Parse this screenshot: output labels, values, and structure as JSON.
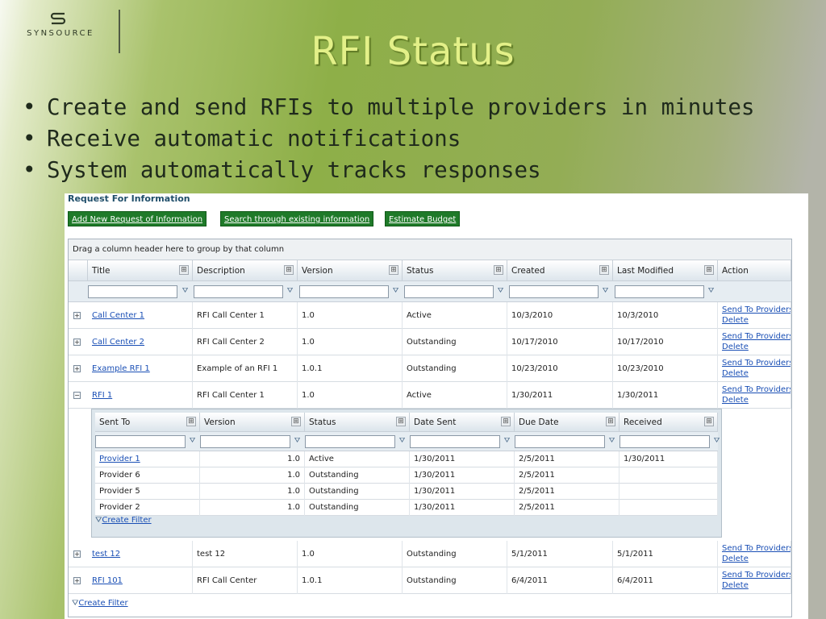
{
  "logo": {
    "text": "SYNSOURCE"
  },
  "slide_title": "RFI Status",
  "bullets": [
    "Create and send RFIs to multiple providers in minutes",
    "Receive automatic notifications",
    "System automatically tracks responses"
  ],
  "panel": {
    "title": "Request For Information",
    "buttons": {
      "add_new": "Add New Request of Information",
      "search": "Search through existing information",
      "estimate": "Estimate Budget"
    },
    "group_hint": "Drag a column header here to group by that column",
    "columns": [
      "Title",
      "Description",
      "Version",
      "Status",
      "Created",
      "Last Modified",
      "Action"
    ],
    "rows": [
      {
        "title": "Call Center 1",
        "description": "RFI Call Center 1",
        "version": "1.0",
        "status": "Active",
        "created": "10/3/2010",
        "modified": "10/3/2010"
      },
      {
        "title": "Call Center 2",
        "description": "RFI Call Center 2",
        "version": "1.0",
        "status": "Outstanding",
        "created": "10/17/2010",
        "modified": "10/17/2010"
      },
      {
        "title": "Example RFI 1",
        "description": "Example of an RFI 1",
        "version": "1.0.1",
        "status": "Outstanding",
        "created": "10/23/2010",
        "modified": "10/23/2010"
      },
      {
        "title": "RFI 1",
        "description": "RFI Call Center 1",
        "version": "1.0",
        "status": "Active",
        "created": "1/30/2011",
        "modified": "1/30/2011"
      },
      {
        "title": "test 12",
        "description": "test 12",
        "version": "1.0",
        "status": "Outstanding",
        "created": "5/1/2011",
        "modified": "5/1/2011"
      },
      {
        "title": "RFI 101",
        "description": "RFI Call Center",
        "version": "1.0.1",
        "status": "Outstanding",
        "created": "6/4/2011",
        "modified": "6/4/2011"
      }
    ],
    "action_send": "Send To Providers",
    "action_delete": "Delete",
    "child": {
      "columns": [
        "Sent To",
        "Version",
        "Status",
        "Date Sent",
        "Due Date",
        "Received"
      ],
      "rows": [
        {
          "sent_to": "Provider 1",
          "version": "1.0",
          "status": "Active",
          "date_sent": "1/30/2011",
          "due_date": "2/5/2011",
          "received": "1/30/2011"
        },
        {
          "sent_to": "Provider 6",
          "version": "1.0",
          "status": "Outstanding",
          "date_sent": "1/30/2011",
          "due_date": "2/5/2011",
          "received": ""
        },
        {
          "sent_to": "Provider 5",
          "version": "1.0",
          "status": "Outstanding",
          "date_sent": "1/30/2011",
          "due_date": "2/5/2011",
          "received": ""
        },
        {
          "sent_to": "Provider 2",
          "version": "1.0",
          "status": "Outstanding",
          "date_sent": "1/30/2011",
          "due_date": "2/5/2011",
          "received": ""
        }
      ],
      "create_filter": "Create Filter"
    },
    "create_filter": "Create Filter"
  },
  "colors": {
    "title": "#e3f088",
    "button_green": "#1f7a29",
    "link": "#1a4fb5"
  },
  "icons": {
    "expand": "plus-box-icon",
    "collapse": "minus-box-icon",
    "filter": "funnel-icon",
    "column_menu": "column-menu-icon"
  }
}
